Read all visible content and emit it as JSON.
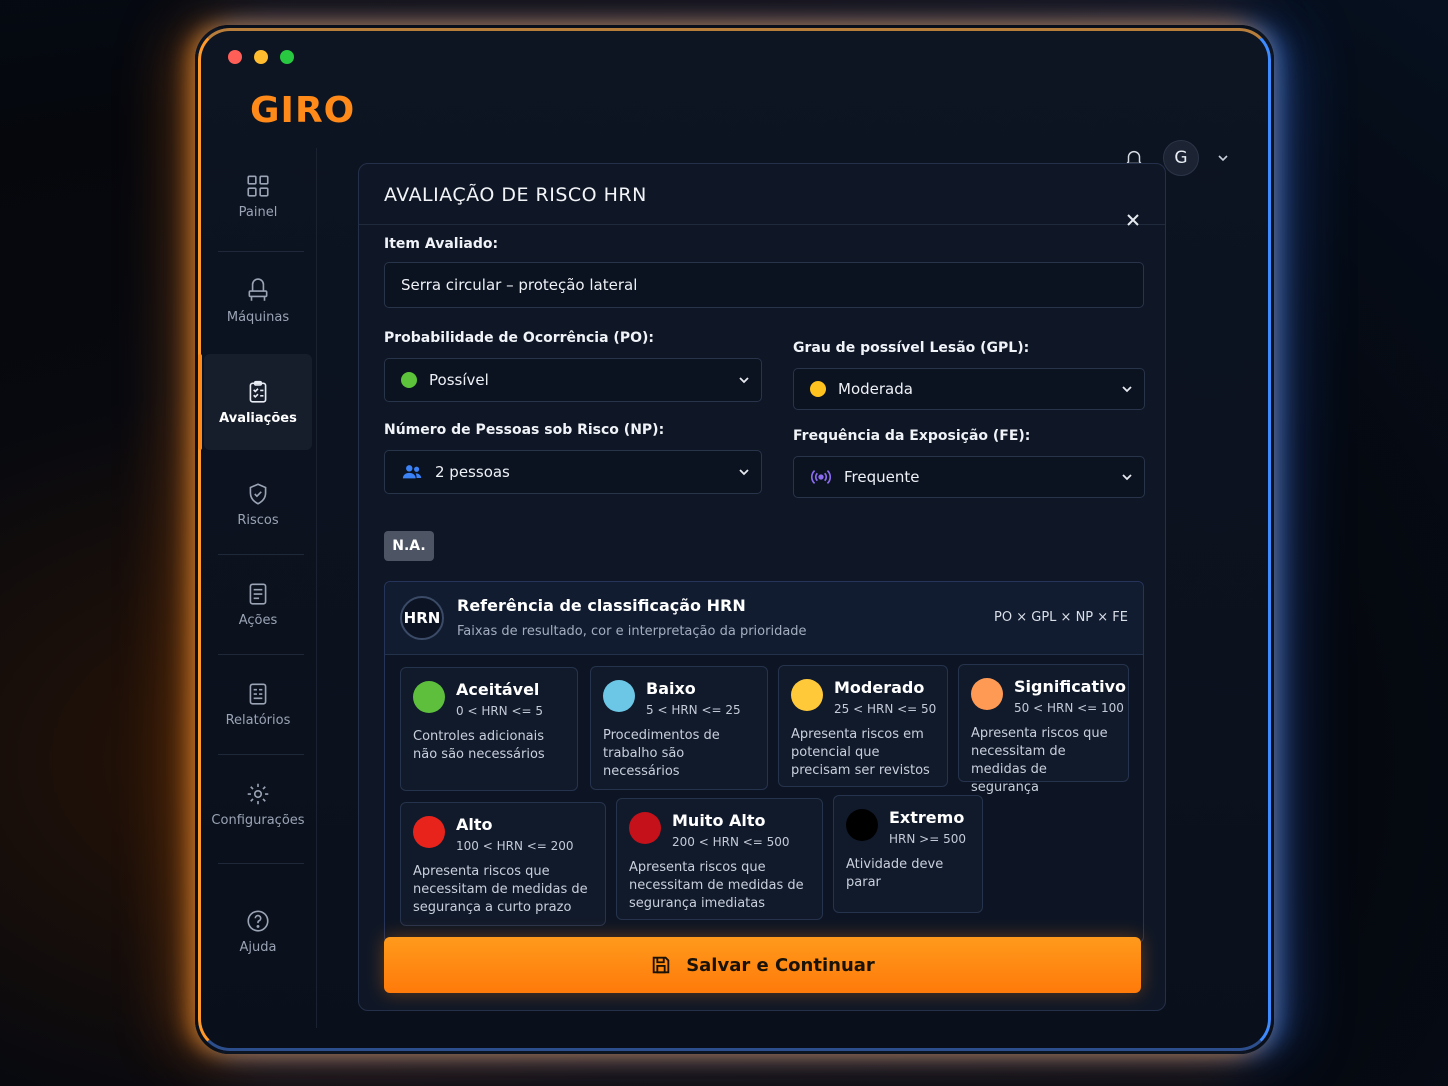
{
  "app": {
    "logo": "GIRO"
  },
  "header": {
    "avatar_initial": "G"
  },
  "sidebar": {
    "items": [
      {
        "label": "Painel",
        "icon": "grid-icon"
      },
      {
        "label": "Máquinas",
        "icon": "machine-icon"
      },
      {
        "label": "Avaliações",
        "icon": "clipboard-icon",
        "active": true
      },
      {
        "label": "Riscos",
        "icon": "shield-icon"
      },
      {
        "label": "Ações",
        "icon": "document-icon"
      },
      {
        "label": "Relatórios",
        "icon": "report-icon"
      },
      {
        "label": "Configurações",
        "icon": "gear-icon"
      },
      {
        "label": "Ajuda",
        "icon": "help-icon"
      }
    ]
  },
  "modal": {
    "title": "AVALIAÇÃO DE RISCO HRN",
    "item_label": "Item Avaliado:",
    "item_value": "Serra circular – proteção lateral",
    "po_label": "Probabilidade de Ocorrência (PO):",
    "po_value": "Possível",
    "po_color": "#5cc33a",
    "gpl_label": "Grau de possível Lesão (GPL):",
    "gpl_value": "Moderada",
    "gpl_color": "#ffc21f",
    "np_label": "Número de Pessoas sob Risco (NP):",
    "np_value": "2 pessoas",
    "fe_label": "Frequência da Exposição (FE):",
    "fe_value": "Frequente",
    "na_label": "N.A.",
    "save_label": "Salvar e Continuar"
  },
  "reference": {
    "badge": "HRN",
    "title": "Referência de classificação HRN",
    "subtitle": "Faixas de resultado, cor e interpretação da prioridade",
    "formula": "PO × GPL × NP × FE",
    "levels": [
      {
        "name": "Aceitável",
        "range": "0 < HRN <= 5",
        "desc": "Controles adicionais não são necessários",
        "color": "#5dbf3c"
      },
      {
        "name": "Baixo",
        "range": "5 < HRN <= 25",
        "desc": "Procedimentos de trabalho são necessários",
        "color": "#6cc7e6"
      },
      {
        "name": "Moderado",
        "range": "25 < HRN <= 50",
        "desc": "Apresenta riscos em potencial que precisam ser revistos",
        "color": "#ffc93a"
      },
      {
        "name": "Significativo",
        "range": "50 < HRN <= 100",
        "desc": "Apresenta riscos que necessitam de medidas de segurança",
        "color": "#ff9a55"
      },
      {
        "name": "Alto",
        "range": "100 < HRN <= 200",
        "desc": "Apresenta riscos que necessitam de medidas de segurança a curto prazo",
        "color": "#e8231c"
      },
      {
        "name": "Muito Alto",
        "range": "200 < HRN <= 500",
        "desc": "Apresenta riscos que necessitam de medidas de segurança imediatas",
        "color": "#c4111a"
      },
      {
        "name": "Extremo",
        "range": "HRN >= 500",
        "desc": "Atividade deve parar",
        "color": "#000000"
      }
    ]
  }
}
